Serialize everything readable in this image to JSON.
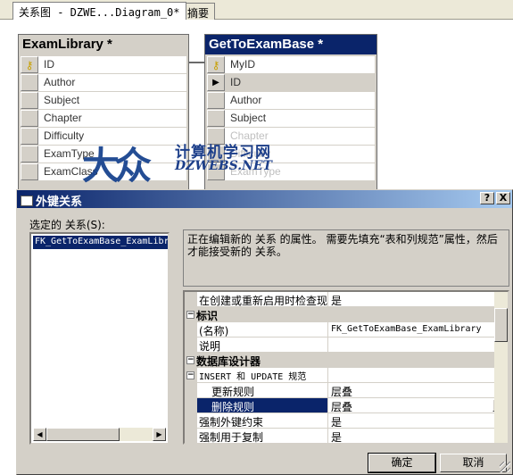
{
  "tabs": {
    "diagram": "关系图 - DZWE...Diagram_0*",
    "summary": "摘要"
  },
  "left_table": {
    "title": "ExamLibrary *",
    "columns": [
      "ID",
      "Author",
      "Subject",
      "Chapter",
      "Difficulty",
      "ExamType",
      "ExamClass"
    ]
  },
  "right_table": {
    "title": "GetToExamBase *",
    "columns": [
      "MyID",
      "ID",
      "Author",
      "Subject",
      "Chapter",
      "Difficulty",
      "ExamType"
    ]
  },
  "watermark": {
    "title": "计算机学习网",
    "subtitle": "DZWEBS.NET"
  },
  "dialog": {
    "title": "外键关系",
    "help": "?",
    "close": "X",
    "selected_label": "选定的 关系(S):",
    "relationship": "FK_GetToExamBase_ExamLibrary",
    "description": "正在编辑新的 关系 的属性。  需要先填充“表和列规范”属性，然后才能接受新的 关系。",
    "props": {
      "check_existing": {
        "name": "在创建或重新启用时检查现有",
        "value": "是"
      },
      "identity": {
        "label": "标识"
      },
      "name": {
        "name": "(名称)",
        "value": "FK_GetToExamBase_ExamLibrary"
      },
      "description": {
        "name": "说明",
        "value": ""
      },
      "designer": {
        "label": "数据库设计器"
      },
      "spec": {
        "label": "INSERT 和 UPDATE 规范"
      },
      "update_rule": {
        "name": "更新规则",
        "value": "层叠"
      },
      "delete_rule": {
        "name": "删除规则",
        "value": "层叠"
      },
      "enforce_fk": {
        "name": "强制外键约束",
        "value": "是"
      },
      "enforce_repl": {
        "name": "强制用于复制",
        "value": "是"
      }
    },
    "ok": "确定",
    "cancel": "取消"
  },
  "colors": {
    "title_bar": "#0a246a",
    "selection": "#0a246a",
    "face": "#d4d0c8"
  }
}
